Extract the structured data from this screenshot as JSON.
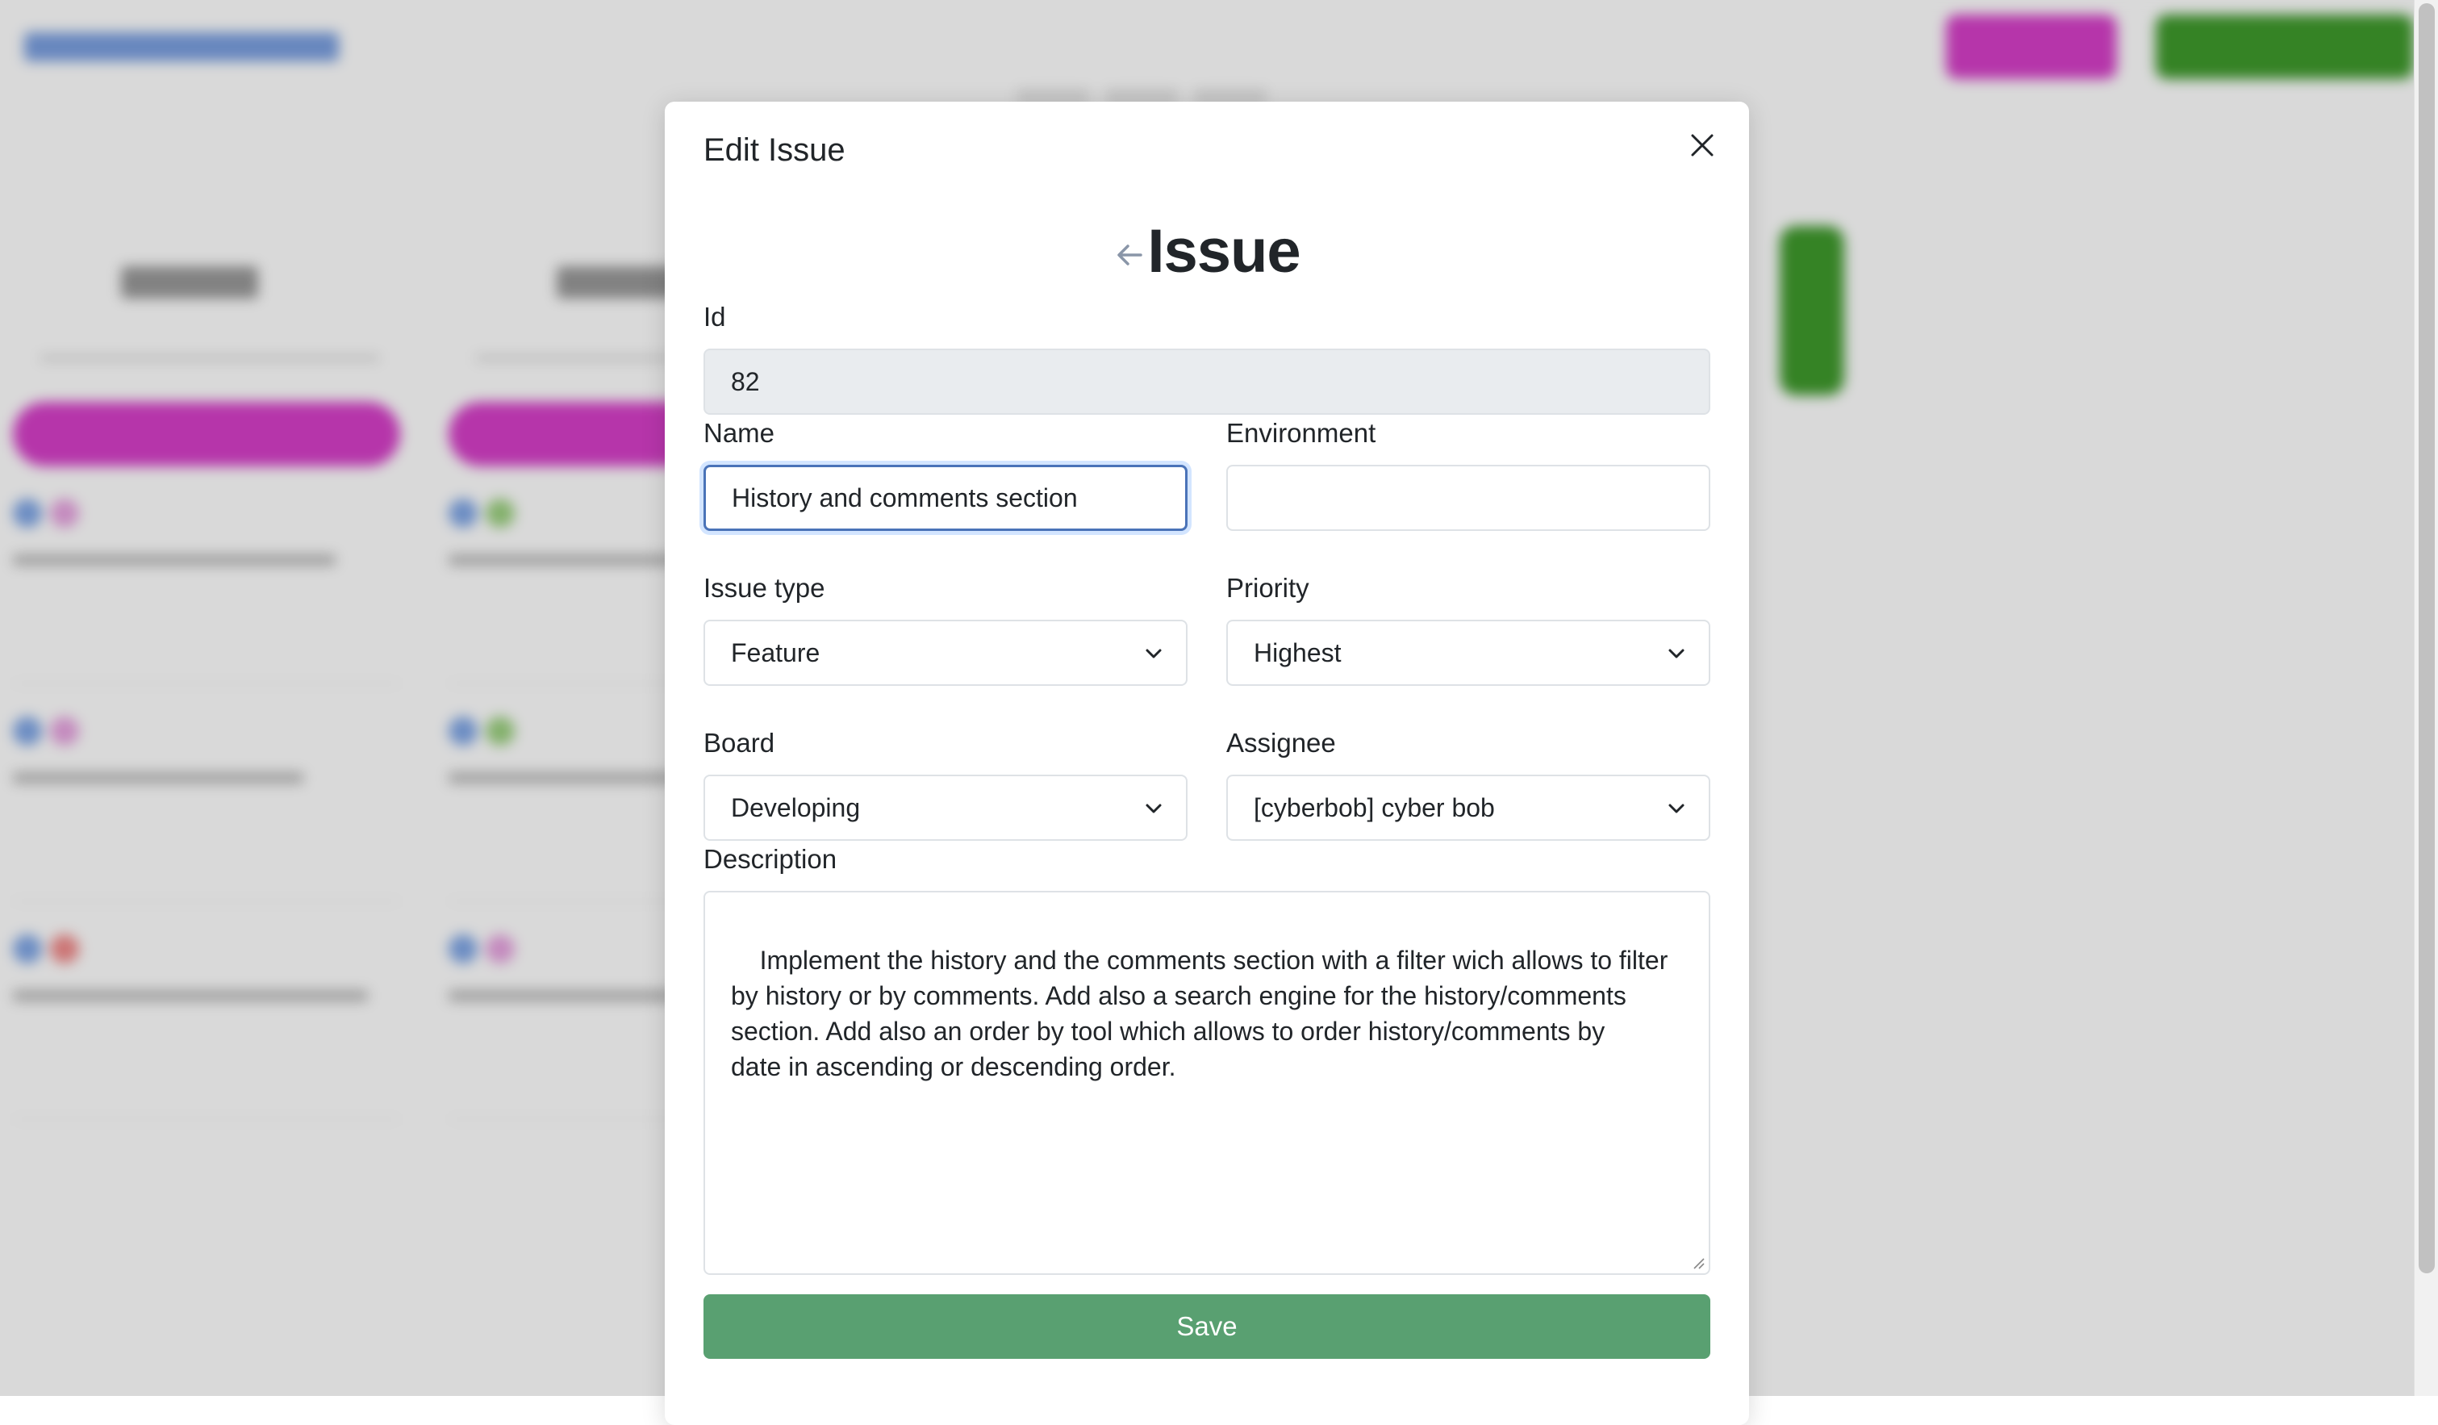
{
  "modal": {
    "title": "Edit Issue",
    "heading": "Issue"
  },
  "form": {
    "id": {
      "label": "Id",
      "value": "82"
    },
    "name": {
      "label": "Name",
      "value": "History and comments section"
    },
    "environment": {
      "label": "Environment",
      "value": ""
    },
    "issue_type": {
      "label": "Issue type",
      "value": "Feature"
    },
    "priority": {
      "label": "Priority",
      "value": "Highest"
    },
    "board": {
      "label": "Board",
      "value": "Developing"
    },
    "assignee": {
      "label": "Assignee",
      "value": "[cyberbob] cyber bob"
    },
    "description": {
      "label": "Description",
      "value": "Implement the history and the comments section with a filter wich allows to filter\nby history or by comments. Add also a search engine for the history/comments\nsection. Add also an order by tool which allows to order history/comments by\ndate in ascending or descending order."
    },
    "save_label": "Save"
  },
  "colors": {
    "save_button": "#59a071",
    "focus_border": "#4a73b8",
    "background_pink_button": "#d63fc8",
    "background_green_button": "#3f9a2c"
  },
  "icons": {
    "close": "close-icon",
    "back": "arrow-left-icon",
    "select_chevron": "chevron-down-icon",
    "resize": "resize-grip-icon"
  }
}
